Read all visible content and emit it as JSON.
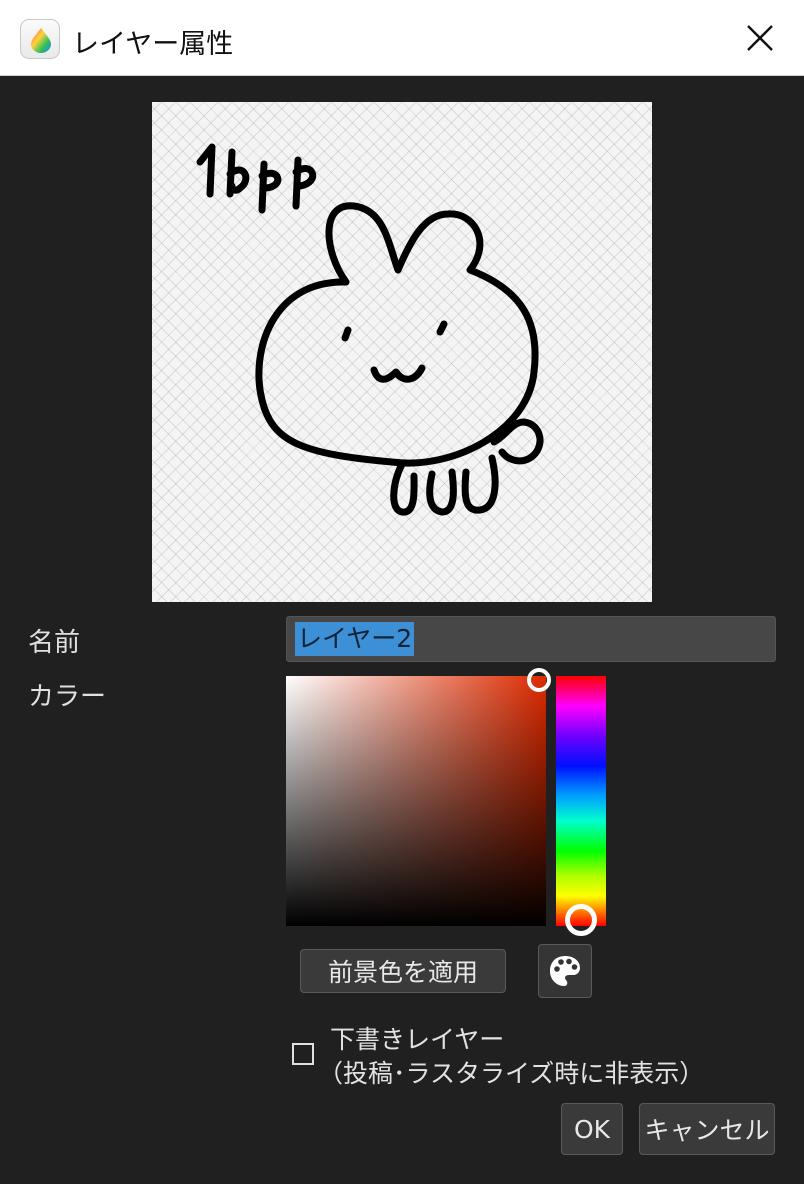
{
  "window": {
    "title": "レイヤー属性",
    "app_icon": "medibang-drop-icon",
    "close_icon": "close-icon"
  },
  "preview": {
    "drawing_text": "1bpp"
  },
  "name_row": {
    "label": "名前",
    "value": "レイヤー2"
  },
  "color_row": {
    "label": "カラー",
    "selected_color": "#dd2a00",
    "hue_color": "#ff0000",
    "apply_foreground_label": "前景色を適用",
    "palette_icon": "palette-icon"
  },
  "draft_layer": {
    "checked": false,
    "label_line1": "下書きレイヤー",
    "label_line2": "（投稿･ラスタライズ時に非表示）"
  },
  "footer": {
    "ok_label": "OK",
    "cancel_label": "キャンセル"
  }
}
